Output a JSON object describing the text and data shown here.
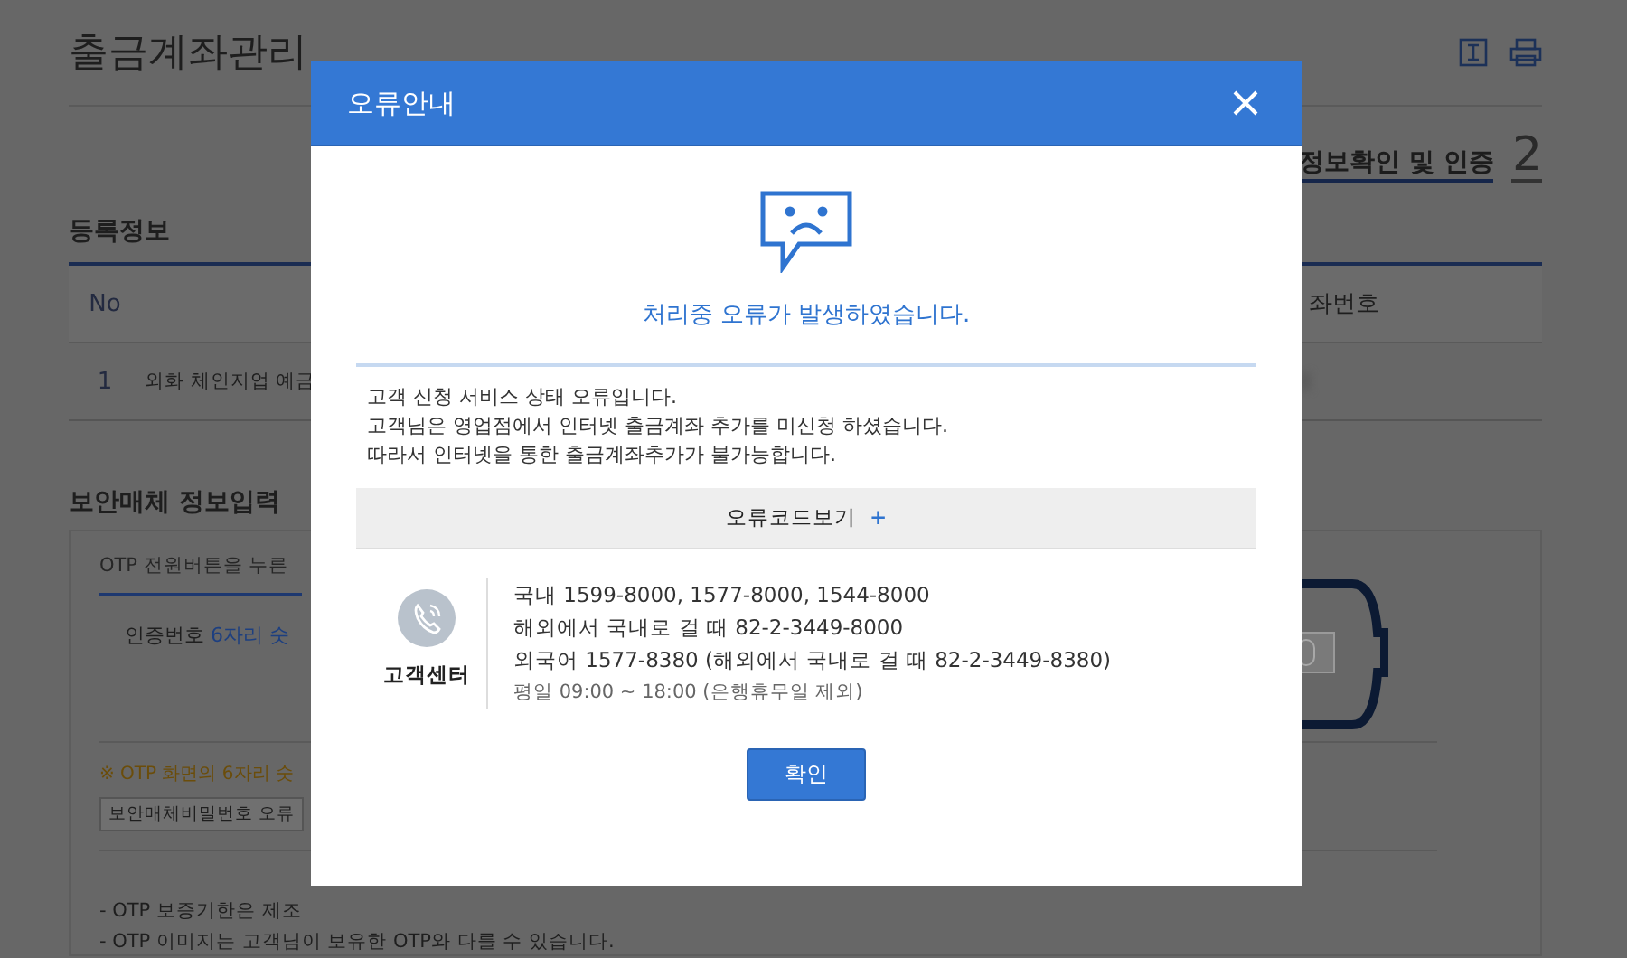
{
  "page": {
    "title": "출금계좌관리",
    "step": {
      "label": "정보확인 및 인증",
      "number": "2"
    }
  },
  "registration": {
    "heading": "등록정보",
    "columns": [
      "No",
      "좌번호"
    ],
    "rows": [
      {
        "no": "1",
        "name": "외화 체인지업 예금"
      }
    ]
  },
  "security": {
    "heading": "보안매체 정보입력",
    "tab": {
      "label": "OTP 전원버튼을 누른",
      "selected": true
    },
    "code_label": "인증번호",
    "code_hint": "6자리 숫",
    "notice": "※ OTP 화면의 6자리 숫",
    "button": "보안매체비밀번호 오류",
    "bullets": [
      "-  OTP 보증기한은 제조",
      "-  OTP 이미지는 고객님이 보유한 OTP와 다를 수 있습니다."
    ]
  },
  "dialog": {
    "title": "오류안내",
    "message": "처리중 오류가 발생하였습니다.",
    "details": [
      "고객 신청 서비스 상태 오류입니다.",
      "고객님은 영업점에서 인터넷 출금계좌 추가를 미신청 하셨습니다.",
      "따라서 인터넷을 통한 출금계좌추가가 불가능합니다."
    ],
    "code_toggle": {
      "label": "오류코드보기",
      "sign": "+"
    },
    "contact": {
      "label": "고객센터",
      "lines": [
        {
          "kind": "phone",
          "text": "국내 1599-8000, 1577-8000, 1544-8000"
        },
        {
          "kind": "phone",
          "text": "해외에서 국내로 걸 때  82-2-3449-8000"
        },
        {
          "kind": "phone",
          "text": "외국어 1577-8380 (해외에서 국내로 걸 때 82-2-3449-8380)"
        },
        {
          "kind": "hours",
          "text": "평일 09:00 ~ 18:00 (은행휴무일 제외)"
        }
      ]
    },
    "confirm": "확인"
  }
}
